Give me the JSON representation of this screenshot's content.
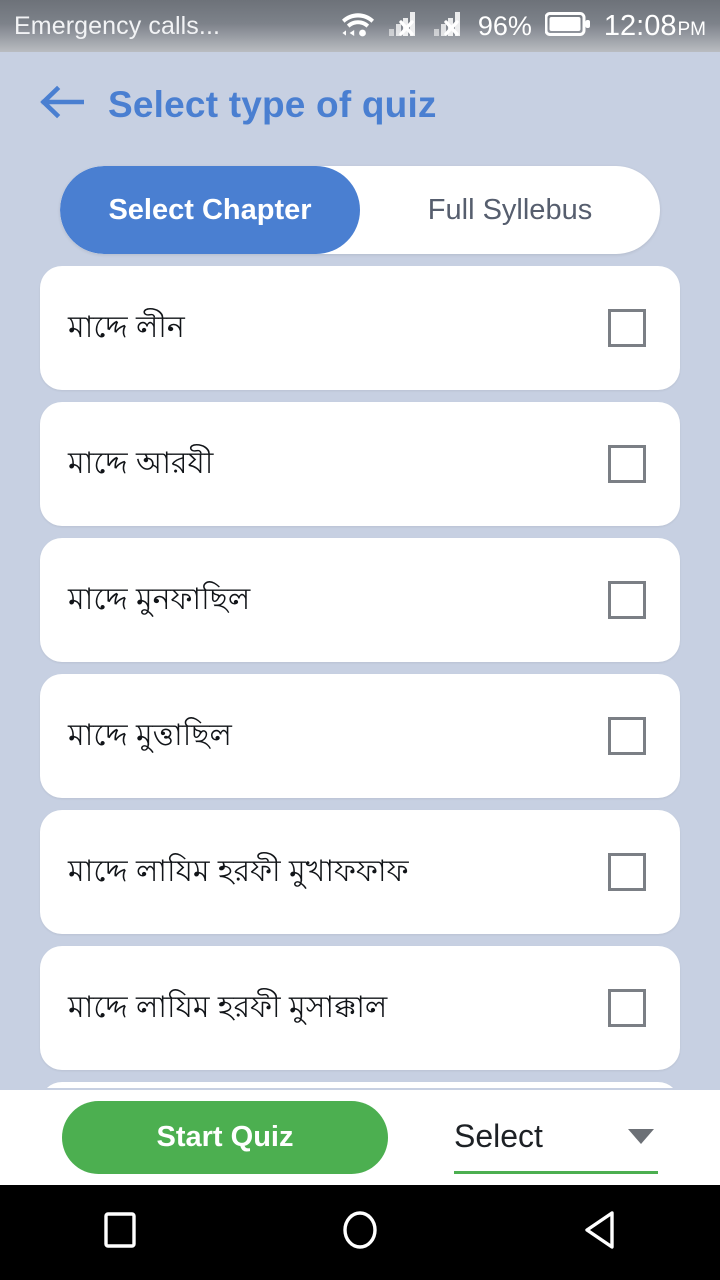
{
  "statusbar": {
    "carrier_text": "Emergency calls...",
    "wifi_icon": "wifi-icon",
    "sim1_icon": "signal-no-service-icon",
    "sim2_icon": "signal-no-service-icon",
    "battery_percent": "96%",
    "battery_icon": "battery-icon",
    "time": "12:08",
    "ampm": "PM"
  },
  "header": {
    "back_icon": "arrow-left-icon",
    "title": "Select type of quiz",
    "title_color": "#4a7fd1"
  },
  "segment": {
    "options": [
      {
        "label": "Select Chapter",
        "active": true
      },
      {
        "label": "Full Syllebus",
        "active": false
      }
    ],
    "active_color": "#4a7fd1",
    "inactive_text_color": "#565e6e"
  },
  "chapters": [
    {
      "label": "মাদ্দে লীন",
      "checked": false
    },
    {
      "label": "মাদ্দে আরযী",
      "checked": false
    },
    {
      "label": "মাদ্দে মুনফাছিল",
      "checked": false
    },
    {
      "label": "মাদ্দে মুত্তাছিল",
      "checked": false
    },
    {
      "label": "মাদ্দে লাযিম হরফী মুখাফফাফ",
      "checked": false
    },
    {
      "label": "মাদ্দে লাযিম হরফী মুসাক্কাল",
      "checked": false
    },
    {
      "label": "",
      "checked": false
    }
  ],
  "bottombar": {
    "start_quiz_label": "Start Quiz",
    "start_quiz_color": "#4caf50",
    "dropdown_value": "Select",
    "dropdown_icon": "chevron-down-icon",
    "dropdown_underline_color": "#4caf50"
  },
  "navbar": {
    "recents_icon": "square-recents-icon",
    "home_icon": "circle-home-icon",
    "back_icon": "triangle-back-icon"
  },
  "background_color": "#c7d0e2"
}
